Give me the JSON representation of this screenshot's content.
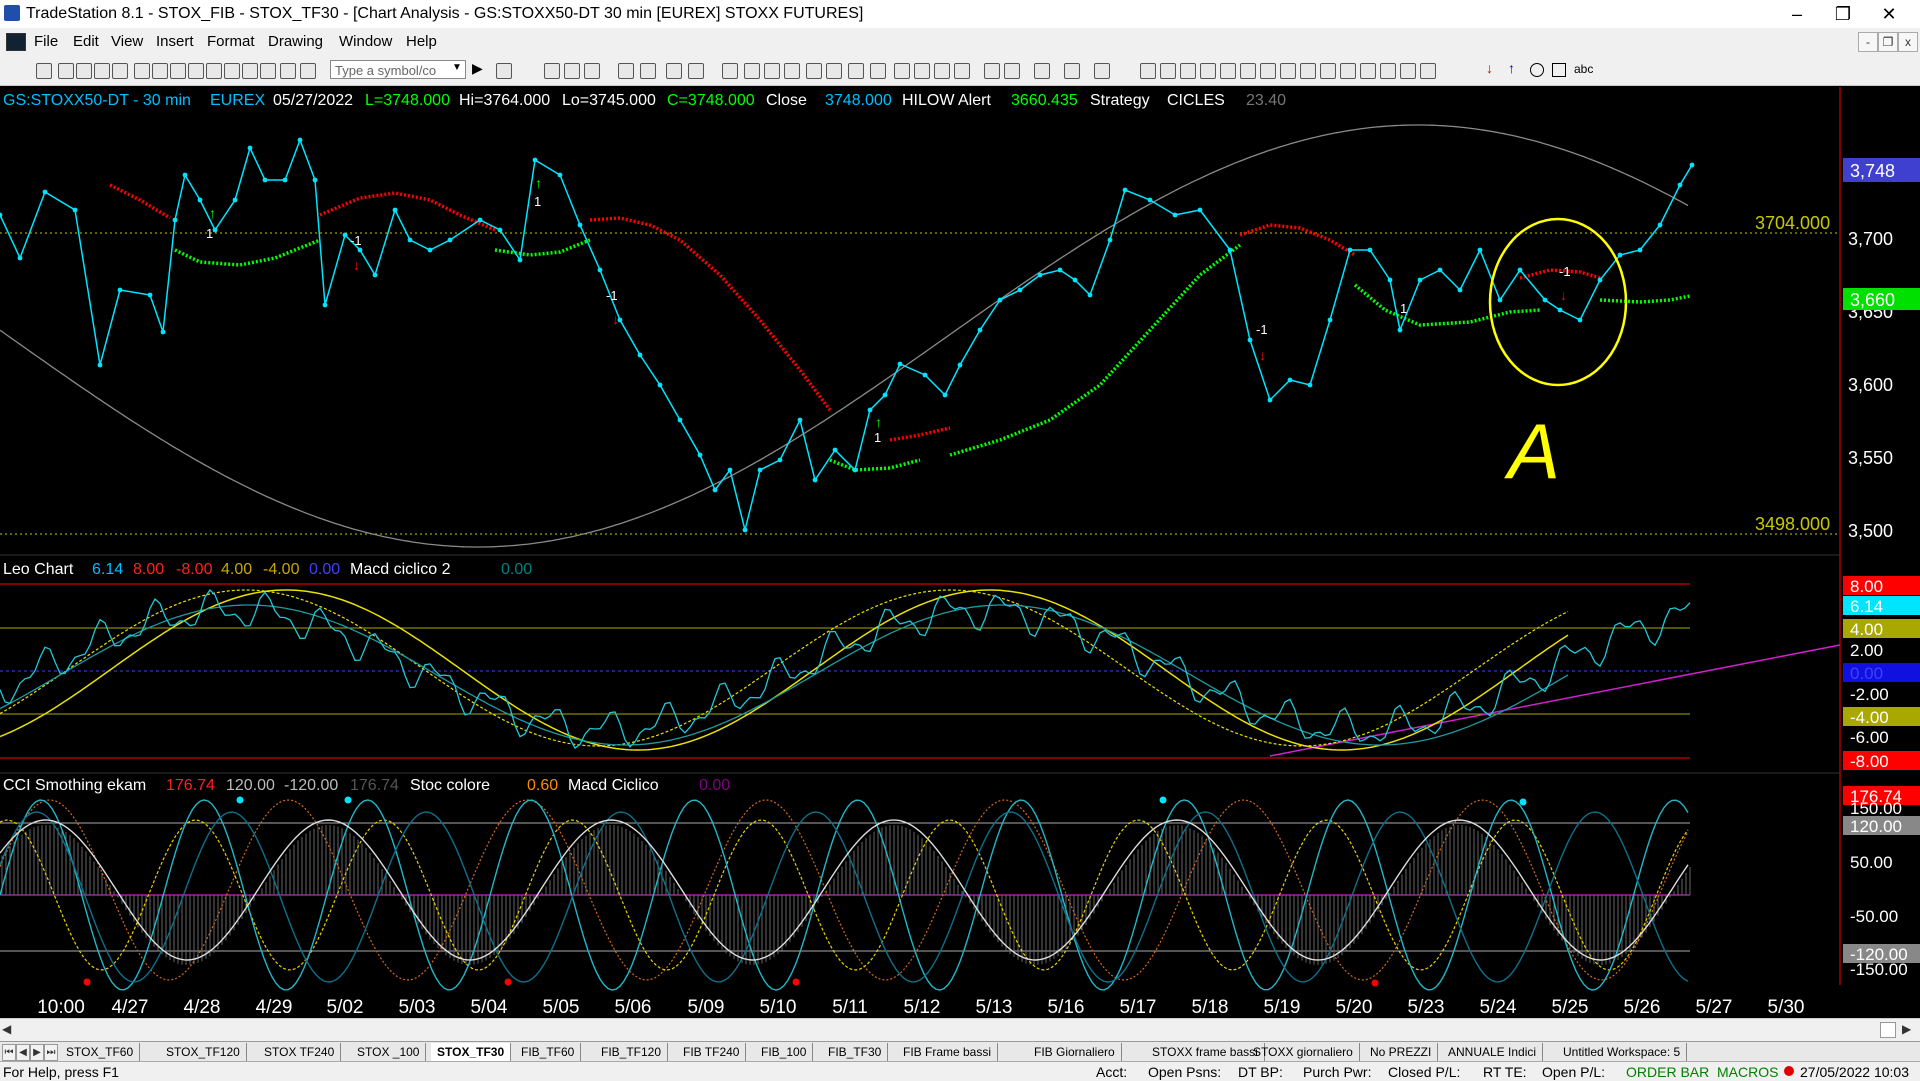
{
  "window": {
    "title": "TradeStation 8.1 - STOX_FIB - STOX_TF30 - [Chart Analysis - GS:STOXX50-DT  30 min  [EUREX] STOXX FUTURES]",
    "controls": [
      "–",
      "❐",
      "✕"
    ]
  },
  "menu": {
    "items": [
      "File",
      "Edit",
      "View",
      "Insert",
      "Format",
      "Drawing",
      "Window",
      "Help"
    ],
    "mdi_controls": [
      "-",
      "❐",
      "x"
    ]
  },
  "toolbar": {
    "symbol_placeholder": "Type a symbol/co",
    "abc_label": "abc"
  },
  "colors": {
    "price": "#00e5ff",
    "hilow_up": "#00ff00",
    "hilow_down": "#ff0000",
    "cycle": "#8a8a8a",
    "annotation": "#ffff00",
    "level": "#c8c800",
    "magenta": "#d020d0"
  },
  "chart_header": {
    "symbol": "GS:STOXX50-DT - 30 min",
    "exchange": "EUREX",
    "date": "05/27/2022",
    "last": "L=3748.000",
    "high": "Hi=3764.000",
    "low": "Lo=3745.000",
    "close_val": "C=3748.000",
    "close_label": "Close",
    "close_num": "3748.000",
    "hilow_label": "HILOW Alert",
    "hilow_val": "3660.435",
    "strategy_label": "Strategy",
    "cicles_label": "CICLES",
    "cicles_val": "23.40"
  },
  "price_panel": {
    "level_top": "3704.000",
    "level_bottom": "3498.000",
    "last_price_badge": "3,748",
    "hilow_badge": "3,660",
    "hidden_label": "3,650",
    "axis_ticks": [
      "3,700",
      "3,600",
      "3,550",
      "3,500"
    ],
    "annotation_letter": "A",
    "signals": [
      {
        "text": "1"
      },
      {
        "text": "-1"
      },
      {
        "text": "1"
      },
      {
        "text": "-1"
      },
      {
        "text": "1"
      },
      {
        "text": "-1"
      },
      {
        "text": "1"
      },
      {
        "text": "-1"
      }
    ]
  },
  "leo_panel": {
    "title": "Leo Chart",
    "v1": "6.14",
    "v2": "8.00",
    "v3": "-8.00",
    "v4": "4.00",
    "v5": "-4.00",
    "v6": "0.00",
    "macd_label": "Macd ciclico 2",
    "macd_val": "0.00",
    "badges": [
      "8.00",
      "6.14",
      "4.00",
      "2.00",
      "0.00",
      "-2.00",
      "-4.00",
      "-6.00",
      "-8.00"
    ]
  },
  "cci_panel": {
    "title": "CCI Smothing ekam",
    "v1": "176.74",
    "v2": "120.00",
    "v3": "-120.00",
    "v4": "176.74",
    "stoc_label": "Stoc colore",
    "stoc_val": "0.60",
    "macd_label": "Macd Ciclico",
    "macd_val": "0.00",
    "badges": [
      "176.74",
      "150.00",
      "120.00",
      "50.00",
      "-50.00",
      "-120.00",
      "-150.00"
    ]
  },
  "time_axis": [
    "10:00",
    "4/27",
    "4/28",
    "4/29",
    "5/02",
    "5/03",
    "5/04",
    "5/05",
    "5/06",
    "5/09",
    "5/10",
    "5/11",
    "5/12",
    "5/13",
    "5/16",
    "5/17",
    "5/18",
    "5/19",
    "5/20",
    "5/23",
    "5/24",
    "5/25",
    "5/26",
    "5/27",
    "5/30"
  ],
  "tabs": [
    "STOX_TF60",
    "STOX_TF120",
    "STOX TF240",
    "STOX _100",
    "STOX_TF30",
    "FIB_TF60",
    "FIB_TF120",
    "FIB TF240",
    "FIB_100",
    "FIB_TF30",
    "FIB Frame bassi",
    "FIB Giornaliero",
    "STOXX frame bassi",
    "STOXX giornaliero",
    "No PREZZI",
    "ANNUALE Indici",
    "Untitled Workspace: 5"
  ],
  "active_tab": "STOX_TF30",
  "status": {
    "help": "For Help, press F1",
    "acct": "Acct:",
    "open_psns": "Open Psns:",
    "dt_bp": "DT BP:",
    "purch_pwr": "Purch Pwr:",
    "closed_pl": "Closed P/L:",
    "rt_te": "RT TE:",
    "open_pl": "Open P/L:",
    "order_bar": "ORDER BAR",
    "macros": "MACROS",
    "datetime": "27/05/2022 10:03"
  }
}
